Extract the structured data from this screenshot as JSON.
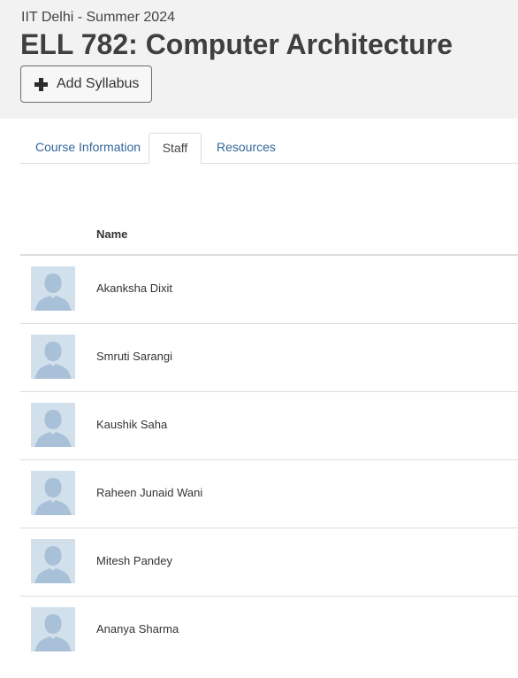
{
  "header": {
    "term": "IIT Delhi - Summer 2024",
    "title": "ELL 782: Computer Architecture",
    "add_syllabus_label": "Add Syllabus",
    "add_icon": "plus-icon"
  },
  "tabs": [
    {
      "label": "Course Information",
      "active": false
    },
    {
      "label": "Staff",
      "active": true
    },
    {
      "label": "Resources",
      "active": false
    }
  ],
  "staff_table": {
    "columns": [
      "",
      "Name"
    ],
    "rows": [
      {
        "name": "Akanksha Dixit",
        "avatar": "default-avatar-icon"
      },
      {
        "name": "Smruti Sarangi",
        "avatar": "default-avatar-icon"
      },
      {
        "name": "Kaushik Saha",
        "avatar": "default-avatar-icon"
      },
      {
        "name": "Raheen Junaid Wani",
        "avatar": "default-avatar-icon"
      },
      {
        "name": "Mitesh Pandey",
        "avatar": "default-avatar-icon"
      },
      {
        "name": "Ananya Sharma",
        "avatar": "default-avatar-icon"
      }
    ]
  },
  "colors": {
    "header_bg": "#f2f2f2",
    "tab_link": "#336699",
    "avatar_bg": "#d2e0ec",
    "avatar_figure": "#a9c1d8"
  }
}
